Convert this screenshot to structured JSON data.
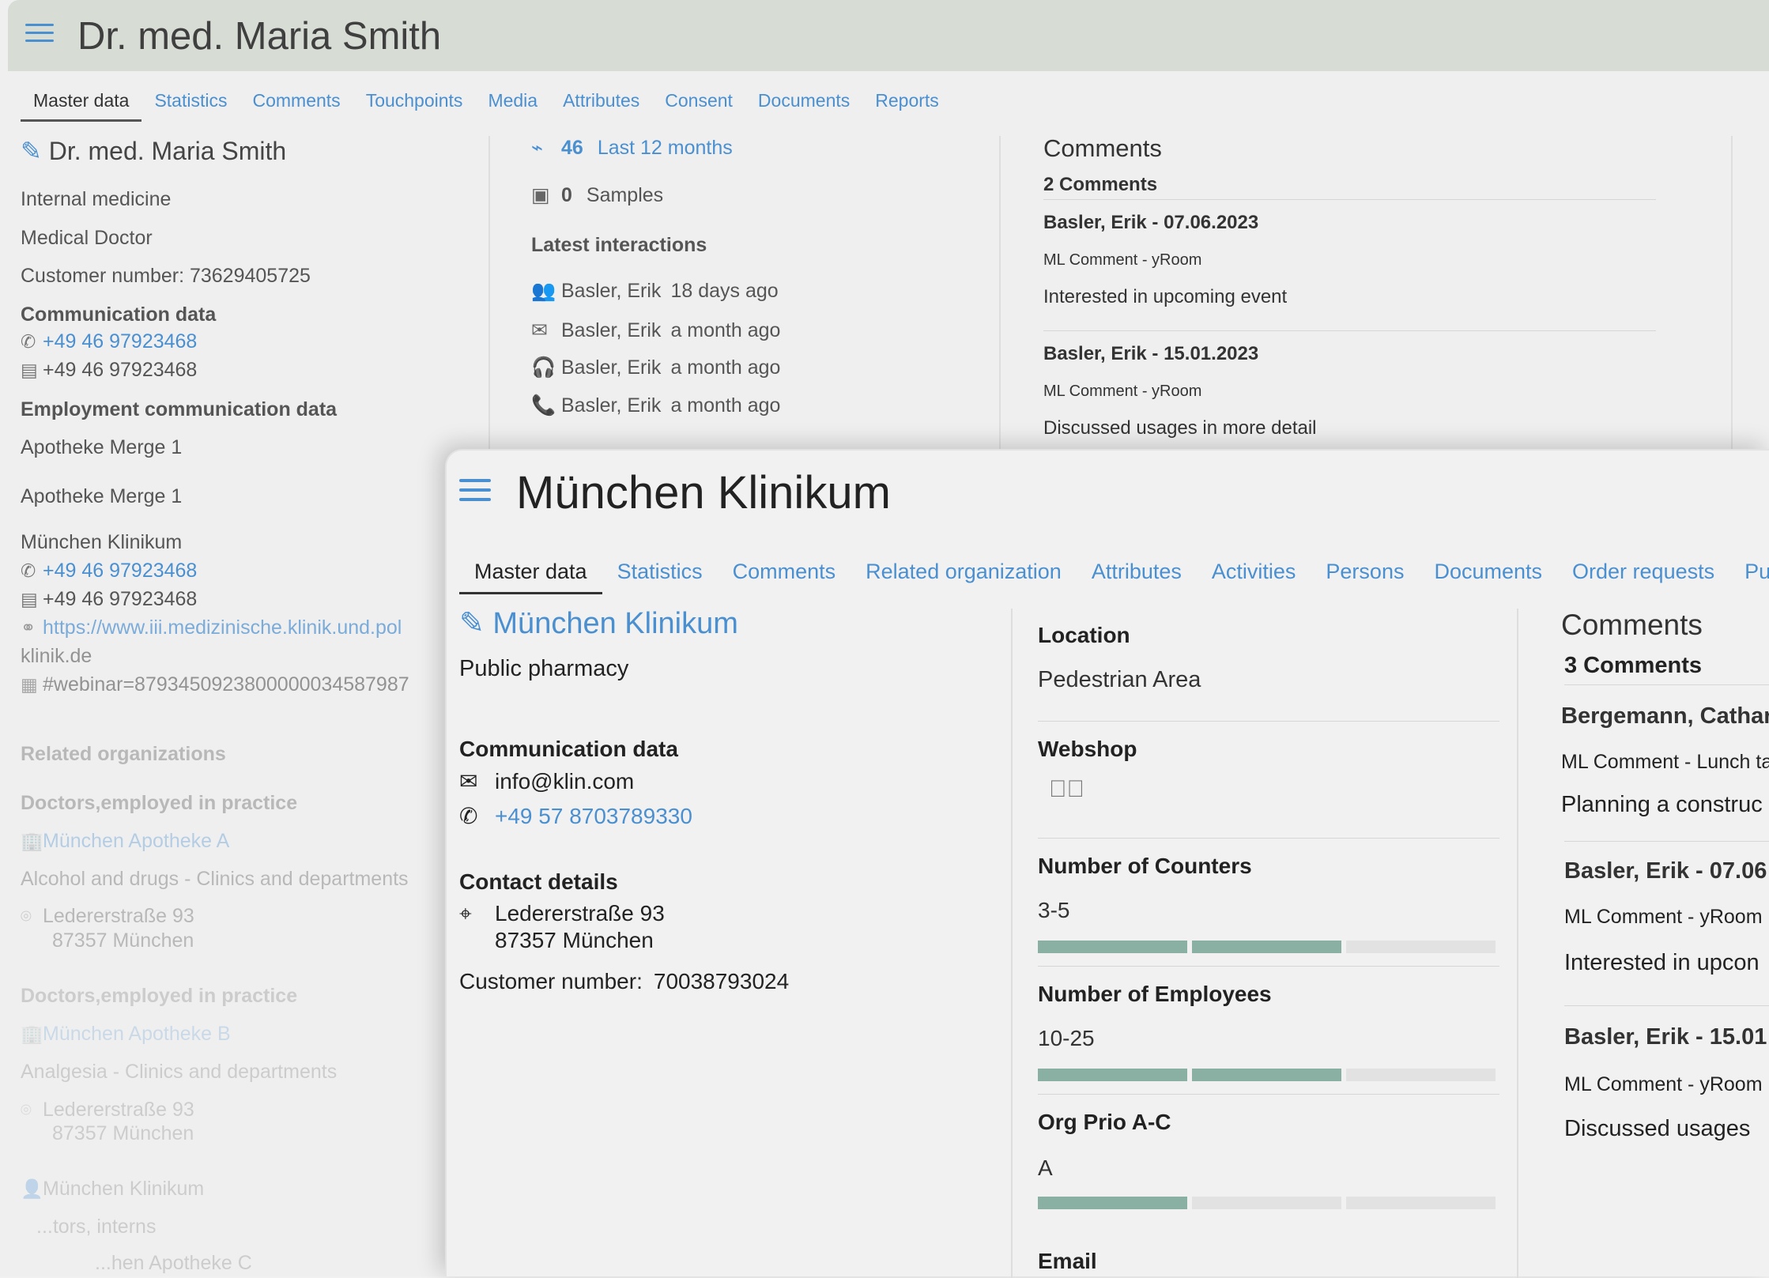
{
  "back": {
    "title": "Dr. med. Maria Smith",
    "tabs": [
      "Master data",
      "Statistics",
      "Comments",
      "Touchpoints",
      "Media",
      "Attributes",
      "Consent",
      "Documents",
      "Reports"
    ],
    "profile": {
      "name": "Dr. med. Maria Smith",
      "specialty": "Internal medicine",
      "role": "Medical Doctor",
      "customer_number": "Customer number: 73629405725",
      "comm_heading": "Communication data",
      "phone": "+49 46 97923468",
      "fax": "+49 46 97923468",
      "employment_heading": "Employment communication data",
      "employer1": "Apotheke Merge 1",
      "employer2": "Apotheke Merge 1",
      "employer3": "München Klinikum",
      "emp_phone": "+49 46 97923468",
      "emp_fax": "+49 46 97923468",
      "url_line1": "https://www.iii.medizinische.klinik.und.pol",
      "url_line2": "klinik.de",
      "webinar": "#webinar=8793450923800000034587987",
      "related_heading": "Related organizations",
      "related": [
        {
          "group": "Doctors,employed in practice",
          "name": "München Apotheke A",
          "dept": "Alcohol and drugs - Clinics and departments",
          "street": "Ledererstraße 93",
          "city": "87357 München"
        },
        {
          "group": "Doctors,employed in practice",
          "name": "München Apotheke B",
          "dept": "Analgesia - Clinics and departments",
          "street": "Ledererstraße 93",
          "city": "87357 München"
        }
      ],
      "extra1": "München Klinikum",
      "extra2": "...tors, interns",
      "extra3": "...hen Apotheke C"
    },
    "stats": {
      "count": "46",
      "period": "Last 12 months",
      "samples_count": "0",
      "samples_label": "Samples",
      "latest_heading": "Latest interactions",
      "interactions": [
        {
          "icon": "meeting-icon",
          "glyph": "👥",
          "who": "Basler, Erik",
          "when": "18 days ago"
        },
        {
          "icon": "mail-icon",
          "glyph": "✉",
          "who": "Basler, Erik",
          "when": "a month ago"
        },
        {
          "icon": "headset-icon",
          "glyph": "🎧",
          "who": "Basler, Erik",
          "when": "a month ago"
        },
        {
          "icon": "phone-icon",
          "glyph": "📞",
          "who": "Basler, Erik",
          "when": "a month ago"
        }
      ]
    },
    "comments": {
      "heading": "Comments",
      "count": "2 Comments",
      "items": [
        {
          "author": "Basler, Erik - 07.06.2023",
          "source": "ML Comment - yRoom",
          "text": "Interested in upcoming event"
        },
        {
          "author": "Basler, Erik - 15.01.2023",
          "source": "ML Comment - yRoom",
          "text": "Discussed usages in more detail"
        }
      ]
    }
  },
  "front": {
    "title": "München Klinikum",
    "tabs": [
      "Master data",
      "Statistics",
      "Comments",
      "Related organization",
      "Attributes",
      "Activities",
      "Persons",
      "Documents",
      "Order requests",
      "Purc"
    ],
    "org": {
      "name": "München Klinikum",
      "type": "Public pharmacy",
      "comm_heading": "Communication data",
      "email": "info@klin.com",
      "phone": "+49 57 8703789330",
      "contact_heading": "Contact details",
      "street": "Ledererstraße 93",
      "city": "87357 München",
      "customer_label": "Customer number:",
      "customer_number": "70038793024"
    },
    "attributes": {
      "location_label": "Location",
      "location_value": "Pedestrian Area",
      "webshop_label": "Webshop",
      "webshop_checked": true,
      "counters_label": "Number of Counters",
      "counters_value": "3-5",
      "counters_level": 2,
      "employees_label": "Number of Employees",
      "employees_value": "10-25",
      "employees_level": 2,
      "prio_label": "Org Prio A-C",
      "prio_value": "A",
      "prio_level": 1,
      "levels_total": 3,
      "email_label": "Email"
    },
    "comments": {
      "heading": "Comments",
      "count": "3 Comments",
      "items": [
        {
          "author": "Bergemann, Cathari",
          "source": "ML Comment - Lunch ta",
          "text": "Planning a construc"
        },
        {
          "author": "Basler, Erik - 07.06",
          "source": "ML Comment - yRoom",
          "text": "Interested in upcon"
        },
        {
          "author": "Basler, Erik - 15.01",
          "source": "ML Comment - yRoom",
          "text": "Discussed usages"
        }
      ]
    }
  },
  "colors": {
    "accent": "#4a8fd0",
    "bar_filled": "#8ab0a3",
    "bar_empty": "#e2e2e2",
    "titlebar": "#d7dcd5"
  }
}
